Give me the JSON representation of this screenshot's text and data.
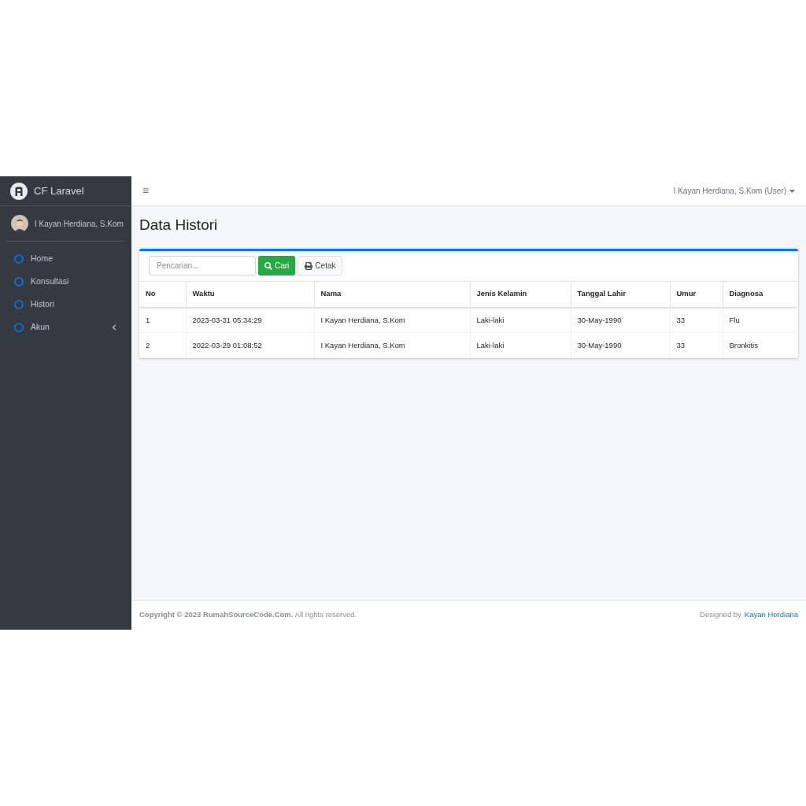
{
  "brand": {
    "title": "CF Laravel"
  },
  "user_panel": {
    "name": "I Kayan Herdiana, S.Kom"
  },
  "sidebar": {
    "items": [
      {
        "label": "Home",
        "kind": "link"
      },
      {
        "label": "Konsultasi",
        "kind": "link"
      },
      {
        "label": "Histori",
        "kind": "link"
      },
      {
        "label": "Akun",
        "kind": "submenu"
      }
    ]
  },
  "navbar": {
    "menu_icon": "≡",
    "user_menu": "I Kayan Herdiana, S.Kom (User)"
  },
  "page_title": "Data Histori",
  "toolbar": {
    "search": {
      "placeholder": "Pencarian..."
    },
    "search_button": "Cari",
    "print_button": "Cetak"
  },
  "table": {
    "columns": [
      "No",
      "Waktu",
      "Nama",
      "Jenis Kelamin",
      "Tanggal Lahir",
      "Umur",
      "Diagnosa"
    ],
    "rows": [
      [
        "1",
        "2023-03-31 05:34:29",
        "I Kayan Herdiana, S.Kom",
        "Laki-laki",
        "30-May-1990",
        "33",
        "Flu"
      ],
      [
        "2",
        "2022-03-29 01:08:52",
        "I Kayan Herdiana, S.Kom",
        "Laki-laki",
        "30-May-1990",
        "33",
        "Bronkitis"
      ]
    ]
  },
  "footer": {
    "copyright": "**Copyright © 2023 RumahSourceCode.Com.** All rights reserved.",
    "designed_by": "Designed by",
    "author_link": "Kayan Herdiana"
  }
}
